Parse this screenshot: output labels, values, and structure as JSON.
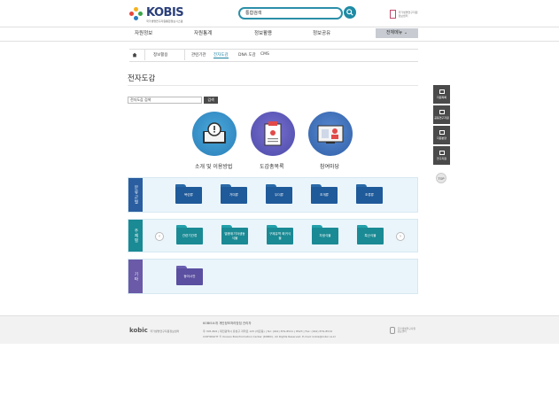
{
  "header": {
    "logo_text": "KOBIS",
    "logo_sub": "국가생명연구자원통합정보시스템",
    "search_value": "통합검색",
    "brand_right": "국가생명연구자원정보센터"
  },
  "nav": {
    "items": [
      "자원정보",
      "자원통계",
      "정보활용",
      "정보공유"
    ],
    "all_menu": "전체메뉴 ⌄"
  },
  "breadcrumb": {
    "section": "정보활용",
    "items": [
      "관련기관",
      "전자도감",
      "DNA 도감",
      "CMS"
    ],
    "active_index": 1
  },
  "page": {
    "title": "전자도감",
    "search_placeholder": "전자도감 검색",
    "search_button": "검색"
  },
  "features": [
    {
      "label": "소개 및 이용방법",
      "color": "#2a8fc6",
      "icon": "book-info-icon"
    },
    {
      "label": "도감총목록",
      "color": "#4a5fb8",
      "icon": "catalog-list-icon"
    },
    {
      "label": "참여마당",
      "color": "#3b6fb8",
      "icon": "participation-icon"
    }
  ],
  "categories": [
    {
      "tab": "분류군별",
      "tab_color": "#2a5ea0",
      "folder_color": "#1f5a9a",
      "folders": [
        "복련류",
        "거미류",
        "두더류",
        "조개류",
        "조류류"
      ]
    },
    {
      "tab": "주제별",
      "tab_color": "#1a8a94",
      "folder_color": "#1a8a94",
      "folders": [
        "관련기관류",
        "멸종위기야생동식물",
        "구제유역 희귀식물",
        "자생식물",
        "특산식물"
      ]
    },
    {
      "tab": "기타",
      "tab_color": "#6a5aa8",
      "folder_color": "#5a4fa0",
      "folders": [
        "동아시안"
      ]
    }
  ],
  "quick_menu": [
    {
      "label": "자원목록",
      "icon": "list-icon"
    },
    {
      "label": "공동연구자원",
      "icon": "doc-icon"
    },
    {
      "label": "자원분양",
      "icon": "share-icon"
    },
    {
      "label": "연구지원",
      "icon": "dna-icon"
    }
  ],
  "top_button": "TOP",
  "footer": {
    "logo": "kobic",
    "logo_sub": "국가생명연구자원정보센터",
    "links": "KOBIS소개    개인정보처리방침    관리자",
    "address": "우 305-806 | 대전광역시 유성구 과학로 125 (어은동) | Tel: (042) 879-8521 | 8523 | Fax: (042) 879-8519",
    "copyright": "COPYRIGHT © Korean Bioinformation Center (KOBIC). All Rights Reserved. E-mail: kobis@kobic.re.kr",
    "right_text": "국가생명연구자원 정보센터"
  },
  "colors": {
    "accent": "#1f8ba4",
    "panel_bg": "#eaf5fb",
    "dark_btn": "#4a4a4a"
  }
}
